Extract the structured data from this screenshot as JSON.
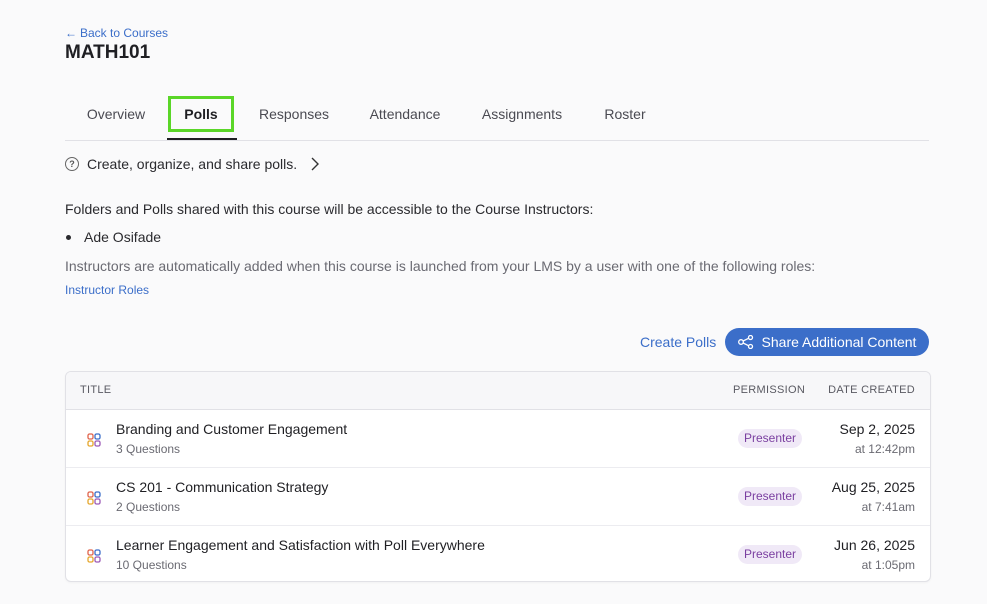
{
  "header": {
    "back_label": "Back to Courses",
    "course_title": "MATH101"
  },
  "tabs": [
    {
      "label": "Overview"
    },
    {
      "label": "Polls",
      "active": true
    },
    {
      "label": "Responses"
    },
    {
      "label": "Attendance"
    },
    {
      "label": "Assignments"
    },
    {
      "label": "Roster"
    }
  ],
  "help": {
    "icon": "question-circle-icon",
    "text": "Create, organize, and share polls."
  },
  "sharing": {
    "info": "Folders and Polls shared with this course will be accessible to the Course Instructors:",
    "instructors": [
      "Ade Osifade"
    ],
    "roles_note": "Instructors are automatically added when this course is launched from your LMS by a user with one of the following roles:",
    "roles_link": "Instructor Roles"
  },
  "actions": {
    "create_polls": "Create Polls",
    "share_additional": "Share Additional Content"
  },
  "table": {
    "columns": {
      "title": "TITLE",
      "permission": "PERMISSION",
      "date_created": "DATE CREATED"
    },
    "rows": [
      {
        "title": "Branding and Customer Engagement",
        "questions": "3 Questions",
        "permission": "Presenter",
        "date": "Sep 2, 2025",
        "time": "at 12:42pm"
      },
      {
        "title": "CS 201 - Communication Strategy",
        "questions": "2 Questions",
        "permission": "Presenter",
        "date": "Aug 25, 2025",
        "time": "at 7:41am"
      },
      {
        "title": "Learner Engagement and Satisfaction with Poll Everywhere",
        "questions": "10 Questions",
        "permission": "Presenter",
        "date": "Jun 26, 2025",
        "time": "at 1:05pm"
      }
    ]
  },
  "colors": {
    "accent": "#3b6ec9",
    "highlight": "#5ad628",
    "badge_bg": "#f0e9f7",
    "badge_text": "#7a3fa0"
  }
}
